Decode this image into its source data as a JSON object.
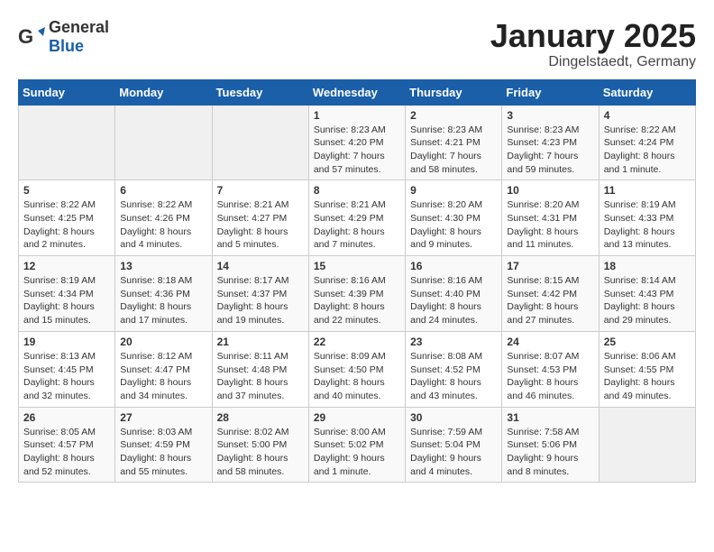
{
  "header": {
    "logo_general": "General",
    "logo_blue": "Blue",
    "month_title": "January 2025",
    "location": "Dingelstaedt, Germany"
  },
  "days_of_week": [
    "Sunday",
    "Monday",
    "Tuesday",
    "Wednesday",
    "Thursday",
    "Friday",
    "Saturday"
  ],
  "weeks": [
    [
      {
        "day": "",
        "info": ""
      },
      {
        "day": "",
        "info": ""
      },
      {
        "day": "",
        "info": ""
      },
      {
        "day": "1",
        "info": "Sunrise: 8:23 AM\nSunset: 4:20 PM\nDaylight: 7 hours and 57 minutes."
      },
      {
        "day": "2",
        "info": "Sunrise: 8:23 AM\nSunset: 4:21 PM\nDaylight: 7 hours and 58 minutes."
      },
      {
        "day": "3",
        "info": "Sunrise: 8:23 AM\nSunset: 4:23 PM\nDaylight: 7 hours and 59 minutes."
      },
      {
        "day": "4",
        "info": "Sunrise: 8:22 AM\nSunset: 4:24 PM\nDaylight: 8 hours and 1 minute."
      }
    ],
    [
      {
        "day": "5",
        "info": "Sunrise: 8:22 AM\nSunset: 4:25 PM\nDaylight: 8 hours and 2 minutes."
      },
      {
        "day": "6",
        "info": "Sunrise: 8:22 AM\nSunset: 4:26 PM\nDaylight: 8 hours and 4 minutes."
      },
      {
        "day": "7",
        "info": "Sunrise: 8:21 AM\nSunset: 4:27 PM\nDaylight: 8 hours and 5 minutes."
      },
      {
        "day": "8",
        "info": "Sunrise: 8:21 AM\nSunset: 4:29 PM\nDaylight: 8 hours and 7 minutes."
      },
      {
        "day": "9",
        "info": "Sunrise: 8:20 AM\nSunset: 4:30 PM\nDaylight: 8 hours and 9 minutes."
      },
      {
        "day": "10",
        "info": "Sunrise: 8:20 AM\nSunset: 4:31 PM\nDaylight: 8 hours and 11 minutes."
      },
      {
        "day": "11",
        "info": "Sunrise: 8:19 AM\nSunset: 4:33 PM\nDaylight: 8 hours and 13 minutes."
      }
    ],
    [
      {
        "day": "12",
        "info": "Sunrise: 8:19 AM\nSunset: 4:34 PM\nDaylight: 8 hours and 15 minutes."
      },
      {
        "day": "13",
        "info": "Sunrise: 8:18 AM\nSunset: 4:36 PM\nDaylight: 8 hours and 17 minutes."
      },
      {
        "day": "14",
        "info": "Sunrise: 8:17 AM\nSunset: 4:37 PM\nDaylight: 8 hours and 19 minutes."
      },
      {
        "day": "15",
        "info": "Sunrise: 8:16 AM\nSunset: 4:39 PM\nDaylight: 8 hours and 22 minutes."
      },
      {
        "day": "16",
        "info": "Sunrise: 8:16 AM\nSunset: 4:40 PM\nDaylight: 8 hours and 24 minutes."
      },
      {
        "day": "17",
        "info": "Sunrise: 8:15 AM\nSunset: 4:42 PM\nDaylight: 8 hours and 27 minutes."
      },
      {
        "day": "18",
        "info": "Sunrise: 8:14 AM\nSunset: 4:43 PM\nDaylight: 8 hours and 29 minutes."
      }
    ],
    [
      {
        "day": "19",
        "info": "Sunrise: 8:13 AM\nSunset: 4:45 PM\nDaylight: 8 hours and 32 minutes."
      },
      {
        "day": "20",
        "info": "Sunrise: 8:12 AM\nSunset: 4:47 PM\nDaylight: 8 hours and 34 minutes."
      },
      {
        "day": "21",
        "info": "Sunrise: 8:11 AM\nSunset: 4:48 PM\nDaylight: 8 hours and 37 minutes."
      },
      {
        "day": "22",
        "info": "Sunrise: 8:09 AM\nSunset: 4:50 PM\nDaylight: 8 hours and 40 minutes."
      },
      {
        "day": "23",
        "info": "Sunrise: 8:08 AM\nSunset: 4:52 PM\nDaylight: 8 hours and 43 minutes."
      },
      {
        "day": "24",
        "info": "Sunrise: 8:07 AM\nSunset: 4:53 PM\nDaylight: 8 hours and 46 minutes."
      },
      {
        "day": "25",
        "info": "Sunrise: 8:06 AM\nSunset: 4:55 PM\nDaylight: 8 hours and 49 minutes."
      }
    ],
    [
      {
        "day": "26",
        "info": "Sunrise: 8:05 AM\nSunset: 4:57 PM\nDaylight: 8 hours and 52 minutes."
      },
      {
        "day": "27",
        "info": "Sunrise: 8:03 AM\nSunset: 4:59 PM\nDaylight: 8 hours and 55 minutes."
      },
      {
        "day": "28",
        "info": "Sunrise: 8:02 AM\nSunset: 5:00 PM\nDaylight: 8 hours and 58 minutes."
      },
      {
        "day": "29",
        "info": "Sunrise: 8:00 AM\nSunset: 5:02 PM\nDaylight: 9 hours and 1 minute."
      },
      {
        "day": "30",
        "info": "Sunrise: 7:59 AM\nSunset: 5:04 PM\nDaylight: 9 hours and 4 minutes."
      },
      {
        "day": "31",
        "info": "Sunrise: 7:58 AM\nSunset: 5:06 PM\nDaylight: 9 hours and 8 minutes."
      },
      {
        "day": "",
        "info": ""
      }
    ]
  ]
}
